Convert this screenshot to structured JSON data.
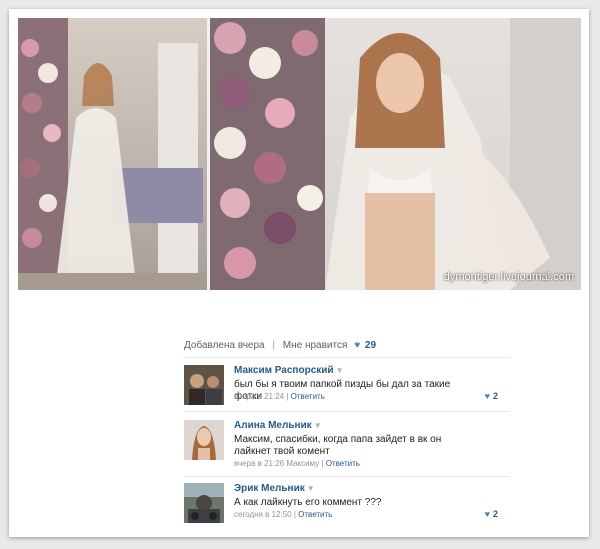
{
  "watermark": "dymontiger.livejournal.com",
  "post_meta": {
    "added": "Добавлена вчера",
    "likes_label": "Мне нравится",
    "heart_icon": "heart-icon",
    "likes_count": "29"
  },
  "comments": [
    {
      "author": "Максим Распорский",
      "text": "был бы я твоим папкой пизды бы дал за такие фотки",
      "time": "вчера в 21:24",
      "separator": "|",
      "reply": "Ответить",
      "likes": "2"
    },
    {
      "author": "Алина Мельник",
      "text": "Максим, спасибки, когда папа зайдет в вк он лайкнет твой комент",
      "time": "вчера в 21:26 Максиму",
      "separator": "|",
      "reply": "Ответить",
      "likes": ""
    },
    {
      "author": "Эрик Мельник",
      "text": "А как лайкнуть его коммент ???",
      "time": "сегодня в 12:50",
      "separator": "|",
      "reply": "Ответить",
      "likes": "2"
    }
  ]
}
